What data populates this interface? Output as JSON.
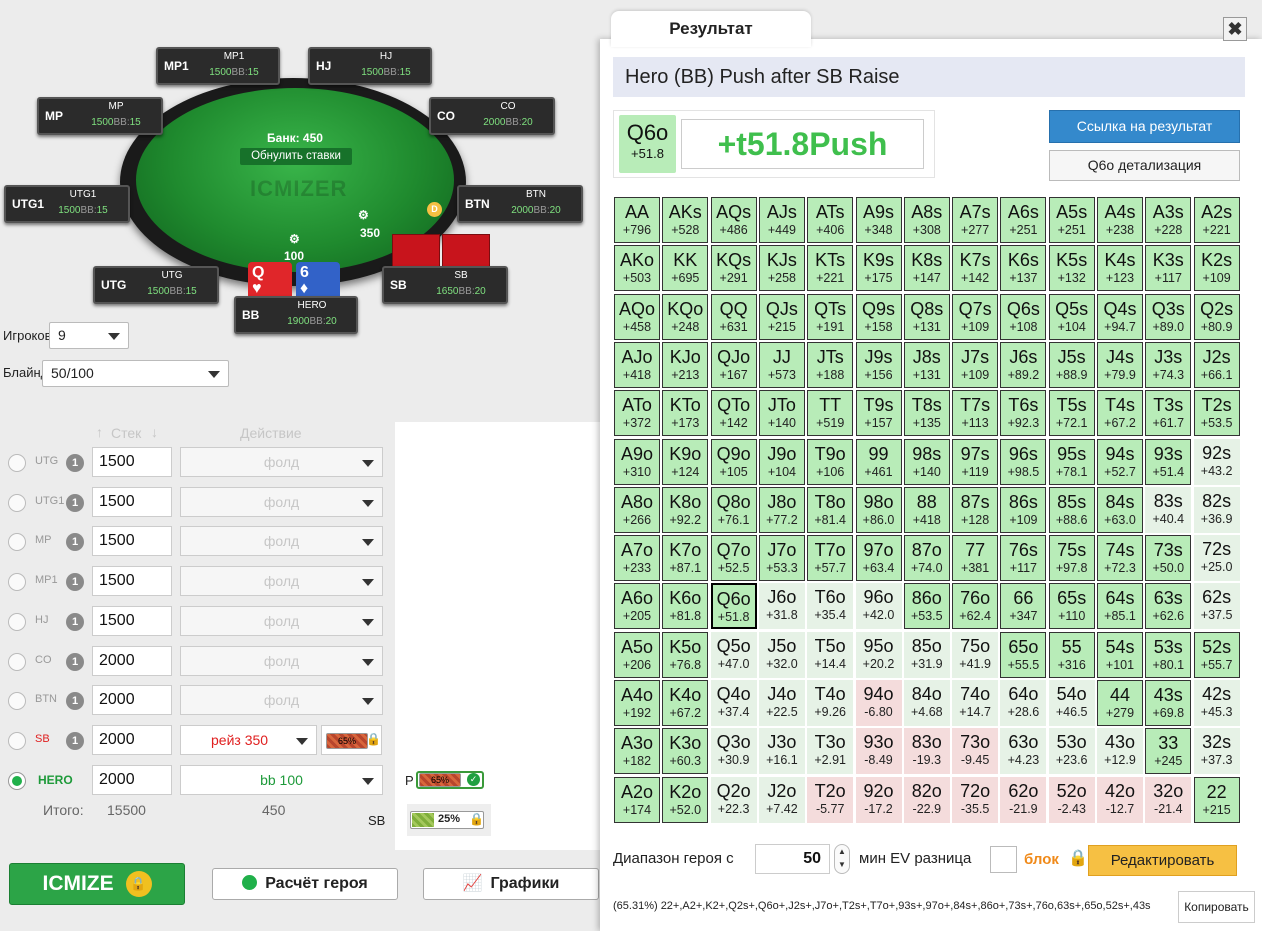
{
  "table": {
    "pot_label": "Банк: 450",
    "reset_bets": "Обнулить ставки",
    "logo": "ICMIZER",
    "dealer": "D",
    "sb_bet": "350",
    "bb_bet": "100",
    "hero_cards": [
      {
        "rank": "Q",
        "suit": "♥"
      },
      {
        "rank": "6",
        "suit": "♦"
      }
    ],
    "seats": [
      {
        "pos": "MP1",
        "name": "MP1",
        "stack": "1500",
        "bb": "15"
      },
      {
        "pos": "HJ",
        "name": "HJ",
        "stack": "1500",
        "bb": "15"
      },
      {
        "pos": "MP",
        "name": "MP",
        "stack": "1500",
        "bb": "15"
      },
      {
        "pos": "CO",
        "name": "CO",
        "stack": "2000",
        "bb": "20"
      },
      {
        "pos": "UTG1",
        "name": "UTG1",
        "stack": "1500",
        "bb": "15"
      },
      {
        "pos": "BTN",
        "name": "BTN",
        "stack": "2000",
        "bb": "20"
      },
      {
        "pos": "UTG",
        "name": "UTG",
        "stack": "1500",
        "bb": "15"
      },
      {
        "pos": "SB",
        "name": "SB",
        "stack": "1650",
        "bb": "20"
      },
      {
        "pos": "BB",
        "name": "HERO",
        "stack": "1900",
        "bb": "20"
      }
    ],
    "bb_suffix": "BB:"
  },
  "settings": {
    "players_label": "Игроков",
    "players_value": "9",
    "blinds_label": "Блайнды",
    "blinds_value": "50/100"
  },
  "players_table": {
    "stack_header": "Стек",
    "action_header": "Действие",
    "rows": [
      {
        "pos": "UTG",
        "num": "1",
        "stack": "1500",
        "action": "фолд"
      },
      {
        "pos": "UTG1",
        "num": "1",
        "stack": "1500",
        "action": "фолд"
      },
      {
        "pos": "MP",
        "num": "1",
        "stack": "1500",
        "action": "фолд"
      },
      {
        "pos": "MP1",
        "num": "1",
        "stack": "1500",
        "action": "фолд"
      },
      {
        "pos": "HJ",
        "num": "1",
        "stack": "1500",
        "action": "фолд"
      },
      {
        "pos": "CO",
        "num": "1",
        "stack": "2000",
        "action": "фолд"
      },
      {
        "pos": "BTN",
        "num": "1",
        "stack": "2000",
        "action": "фолд"
      },
      {
        "pos": "SB",
        "num": "1",
        "stack": "2000",
        "action": "рейз 350",
        "pct": "65%"
      },
      {
        "pos": "HERO",
        "num": "",
        "stack": "2000",
        "action": "bb 100"
      }
    ],
    "total_label": "Итого:",
    "total_stack": "15500",
    "total_bets": "450"
  },
  "ranges": {
    "p_label": "P",
    "p_pct": "65%",
    "sb_label": "SB",
    "sb_pct": "25%"
  },
  "buttons": {
    "icmize": "ICMIZE",
    "hero_calc": "Расчёт героя",
    "graphs": "Графики"
  },
  "result": {
    "tab": "Результат",
    "close": "✖",
    "title": "Hero (BB) Push after SB Raise",
    "hand": "Q6o",
    "hand_ev": "+51.8",
    "ev_text": "+t51.8Push",
    "link_button": "Ссылка на результат",
    "detail_button": "Q6o детализация",
    "range_label": "Диапазон героя с",
    "range_value": "50",
    "min_ev_label": "мин EV разница",
    "block_label": "блок",
    "edit_button": "Редактировать",
    "range_string": "(65.31%) 22+,A2+,K2+,Q2s+,Q6o+,J2s+,J7o+,T2s+,T7o+,93s+,97o+,84s+,86o+,73s+,76o,63s+,65o,52s+,43s",
    "copy_button": "Копировать"
  },
  "grid": [
    [
      [
        "AA",
        "+796",
        1
      ],
      [
        "AKs",
        "+528",
        1
      ],
      [
        "AQs",
        "+486",
        1
      ],
      [
        "AJs",
        "+449",
        1
      ],
      [
        "ATs",
        "+406",
        1
      ],
      [
        "A9s",
        "+348",
        1
      ],
      [
        "A8s",
        "+308",
        1
      ],
      [
        "A7s",
        "+277",
        1
      ],
      [
        "A6s",
        "+251",
        1
      ],
      [
        "A5s",
        "+251",
        1
      ],
      [
        "A4s",
        "+238",
        1
      ],
      [
        "A3s",
        "+228",
        1
      ],
      [
        "A2s",
        "+221",
        1
      ]
    ],
    [
      [
        "AKo",
        "+503",
        1
      ],
      [
        "KK",
        "+695",
        1
      ],
      [
        "KQs",
        "+291",
        1
      ],
      [
        "KJs",
        "+258",
        1
      ],
      [
        "KTs",
        "+221",
        1
      ],
      [
        "K9s",
        "+175",
        1
      ],
      [
        "K8s",
        "+147",
        1
      ],
      [
        "K7s",
        "+142",
        1
      ],
      [
        "K6s",
        "+137",
        1
      ],
      [
        "K5s",
        "+132",
        1
      ],
      [
        "K4s",
        "+123",
        1
      ],
      [
        "K3s",
        "+117",
        1
      ],
      [
        "K2s",
        "+109",
        1
      ]
    ],
    [
      [
        "AQo",
        "+458",
        1
      ],
      [
        "KQo",
        "+248",
        1
      ],
      [
        "QQ",
        "+631",
        1
      ],
      [
        "QJs",
        "+215",
        1
      ],
      [
        "QTs",
        "+191",
        1
      ],
      [
        "Q9s",
        "+158",
        1
      ],
      [
        "Q8s",
        "+131",
        1
      ],
      [
        "Q7s",
        "+109",
        1
      ],
      [
        "Q6s",
        "+108",
        1
      ],
      [
        "Q5s",
        "+104",
        1
      ],
      [
        "Q4s",
        "+94.7",
        1
      ],
      [
        "Q3s",
        "+89.0",
        1
      ],
      [
        "Q2s",
        "+80.9",
        1
      ]
    ],
    [
      [
        "AJo",
        "+418",
        1
      ],
      [
        "KJo",
        "+213",
        1
      ],
      [
        "QJo",
        "+167",
        1
      ],
      [
        "JJ",
        "+573",
        1
      ],
      [
        "JTs",
        "+188",
        1
      ],
      [
        "J9s",
        "+156",
        1
      ],
      [
        "J8s",
        "+131",
        1
      ],
      [
        "J7s",
        "+109",
        1
      ],
      [
        "J6s",
        "+89.2",
        1
      ],
      [
        "J5s",
        "+88.9",
        1
      ],
      [
        "J4s",
        "+79.9",
        1
      ],
      [
        "J3s",
        "+74.3",
        1
      ],
      [
        "J2s",
        "+66.1",
        1
      ]
    ],
    [
      [
        "ATo",
        "+372",
        1
      ],
      [
        "KTo",
        "+173",
        1
      ],
      [
        "QTo",
        "+142",
        1
      ],
      [
        "JTo",
        "+140",
        1
      ],
      [
        "TT",
        "+519",
        1
      ],
      [
        "T9s",
        "+157",
        1
      ],
      [
        "T8s",
        "+135",
        1
      ],
      [
        "T7s",
        "+113",
        1
      ],
      [
        "T6s",
        "+92.3",
        1
      ],
      [
        "T5s",
        "+72.1",
        1
      ],
      [
        "T4s",
        "+67.2",
        1
      ],
      [
        "T3s",
        "+61.7",
        1
      ],
      [
        "T2s",
        "+53.5",
        1
      ]
    ],
    [
      [
        "A9o",
        "+310",
        1
      ],
      [
        "K9o",
        "+124",
        1
      ],
      [
        "Q9o",
        "+105",
        1
      ],
      [
        "J9o",
        "+104",
        1
      ],
      [
        "T9o",
        "+106",
        1
      ],
      [
        "99",
        "+461",
        1
      ],
      [
        "98s",
        "+140",
        1
      ],
      [
        "97s",
        "+119",
        1
      ],
      [
        "96s",
        "+98.5",
        1
      ],
      [
        "95s",
        "+78.1",
        1
      ],
      [
        "94s",
        "+52.7",
        1
      ],
      [
        "93s",
        "+51.4",
        1
      ],
      [
        "92s",
        "+43.2",
        0
      ]
    ],
    [
      [
        "A8o",
        "+266",
        1
      ],
      [
        "K8o",
        "+92.2",
        1
      ],
      [
        "Q8o",
        "+76.1",
        1
      ],
      [
        "J8o",
        "+77.2",
        1
      ],
      [
        "T8o",
        "+81.4",
        1
      ],
      [
        "98o",
        "+86.0",
        1
      ],
      [
        "88",
        "+418",
        1
      ],
      [
        "87s",
        "+128",
        1
      ],
      [
        "86s",
        "+109",
        1
      ],
      [
        "85s",
        "+88.6",
        1
      ],
      [
        "84s",
        "+63.0",
        1
      ],
      [
        "83s",
        "+40.4",
        0
      ],
      [
        "82s",
        "+36.9",
        0
      ]
    ],
    [
      [
        "A7o",
        "+233",
        1
      ],
      [
        "K7o",
        "+87.1",
        1
      ],
      [
        "Q7o",
        "+52.5",
        1
      ],
      [
        "J7o",
        "+53.3",
        1
      ],
      [
        "T7o",
        "+57.7",
        1
      ],
      [
        "97o",
        "+63.4",
        1
      ],
      [
        "87o",
        "+74.0",
        1
      ],
      [
        "77",
        "+381",
        1
      ],
      [
        "76s",
        "+117",
        1
      ],
      [
        "75s",
        "+97.8",
        1
      ],
      [
        "74s",
        "+72.3",
        1
      ],
      [
        "73s",
        "+50.0",
        1
      ],
      [
        "72s",
        "+25.0",
        0
      ]
    ],
    [
      [
        "A6o",
        "+205",
        1
      ],
      [
        "K6o",
        "+81.8",
        1
      ],
      [
        "Q6o",
        "+51.8",
        2
      ],
      [
        "J6o",
        "+31.8",
        0
      ],
      [
        "T6o",
        "+35.4",
        0
      ],
      [
        "96o",
        "+42.0",
        0
      ],
      [
        "86o",
        "+53.5",
        1
      ],
      [
        "76o",
        "+62.4",
        1
      ],
      [
        "66",
        "+347",
        1
      ],
      [
        "65s",
        "+110",
        1
      ],
      [
        "64s",
        "+85.1",
        1
      ],
      [
        "63s",
        "+62.6",
        1
      ],
      [
        "62s",
        "+37.5",
        0
      ]
    ],
    [
      [
        "A5o",
        "+206",
        1
      ],
      [
        "K5o",
        "+76.8",
        1
      ],
      [
        "Q5o",
        "+47.0",
        0
      ],
      [
        "J5o",
        "+32.0",
        0
      ],
      [
        "T5o",
        "+14.4",
        0
      ],
      [
        "95o",
        "+20.2",
        0
      ],
      [
        "85o",
        "+31.9",
        0
      ],
      [
        "75o",
        "+41.9",
        0
      ],
      [
        "65o",
        "+55.5",
        1
      ],
      [
        "55",
        "+316",
        1
      ],
      [
        "54s",
        "+101",
        1
      ],
      [
        "53s",
        "+80.1",
        1
      ],
      [
        "52s",
        "+55.7",
        1
      ]
    ],
    [
      [
        "A4o",
        "+192",
        1
      ],
      [
        "K4o",
        "+67.2",
        1
      ],
      [
        "Q4o",
        "+37.4",
        0
      ],
      [
        "J4o",
        "+22.5",
        0
      ],
      [
        "T4o",
        "+9.26",
        0
      ],
      [
        "94o",
        "-6.80",
        -1
      ],
      [
        "84o",
        "+4.68",
        0
      ],
      [
        "74o",
        "+14.7",
        0
      ],
      [
        "64o",
        "+28.6",
        0
      ],
      [
        "54o",
        "+46.5",
        0
      ],
      [
        "44",
        "+279",
        1
      ],
      [
        "43s",
        "+69.8",
        1
      ],
      [
        "42s",
        "+45.3",
        0
      ]
    ],
    [
      [
        "A3o",
        "+182",
        1
      ],
      [
        "K3o",
        "+60.3",
        1
      ],
      [
        "Q3o",
        "+30.9",
        0
      ],
      [
        "J3o",
        "+16.1",
        0
      ],
      [
        "T3o",
        "+2.91",
        0
      ],
      [
        "93o",
        "-8.49",
        -1
      ],
      [
        "83o",
        "-19.3",
        -1
      ],
      [
        "73o",
        "-9.45",
        -1
      ],
      [
        "63o",
        "+4.23",
        0
      ],
      [
        "53o",
        "+23.6",
        0
      ],
      [
        "43o",
        "+12.9",
        0
      ],
      [
        "33",
        "+245",
        1
      ],
      [
        "32s",
        "+37.3",
        0
      ]
    ],
    [
      [
        "A2o",
        "+174",
        1
      ],
      [
        "K2o",
        "+52.0",
        1
      ],
      [
        "Q2o",
        "+22.3",
        0
      ],
      [
        "J2o",
        "+7.42",
        0
      ],
      [
        "T2o",
        "-5.77",
        -1
      ],
      [
        "92o",
        "-17.2",
        -1
      ],
      [
        "82o",
        "-22.9",
        -1
      ],
      [
        "72o",
        "-35.5",
        -1
      ],
      [
        "62o",
        "-21.9",
        -1
      ],
      [
        "52o",
        "-2.43",
        -1
      ],
      [
        "42o",
        "-12.7",
        -1
      ],
      [
        "32o",
        "-21.4",
        -1
      ],
      [
        "22",
        "+215",
        1
      ]
    ]
  ]
}
